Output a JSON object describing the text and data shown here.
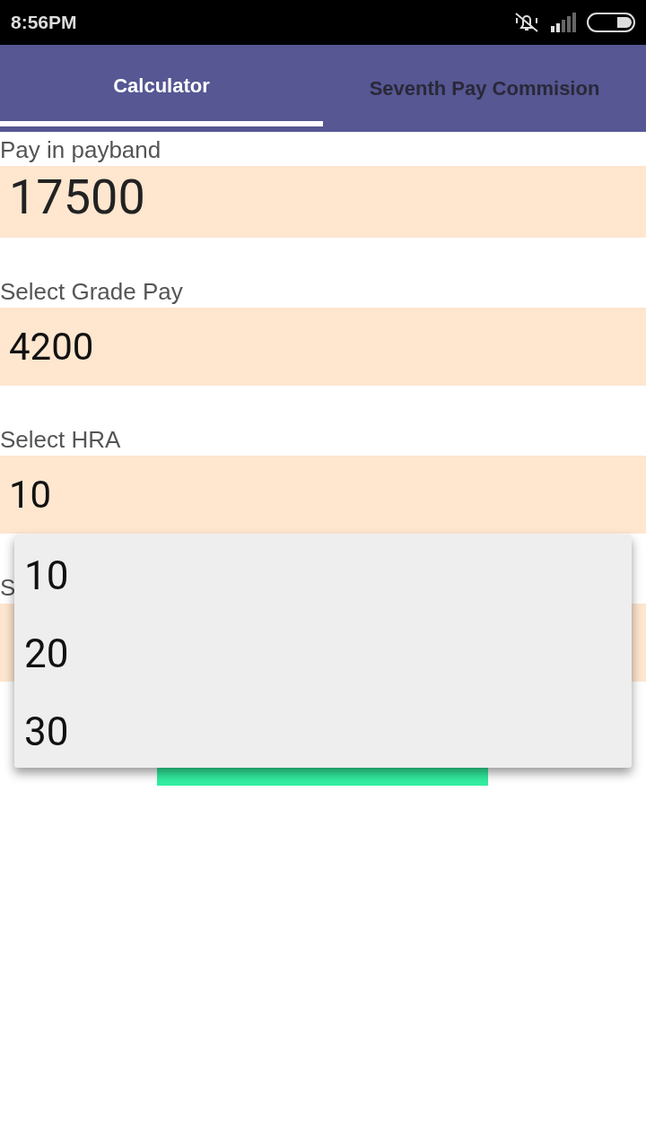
{
  "status_bar": {
    "time": "8:56PM"
  },
  "tabs": [
    {
      "label": "Calculator",
      "selected": true
    },
    {
      "label": "Seventh Pay Commision",
      "selected": false
    }
  ],
  "fields": [
    {
      "label": "Pay in payband",
      "value": "17500",
      "kind": "input"
    },
    {
      "label": "Select Grade Pay",
      "value": "4200",
      "kind": "select"
    },
    {
      "label": "Select HRA",
      "value": "10",
      "kind": "select"
    },
    {
      "label": "S",
      "kind": "select"
    }
  ],
  "dropdown": {
    "options": [
      "10",
      "20",
      "30"
    ]
  }
}
